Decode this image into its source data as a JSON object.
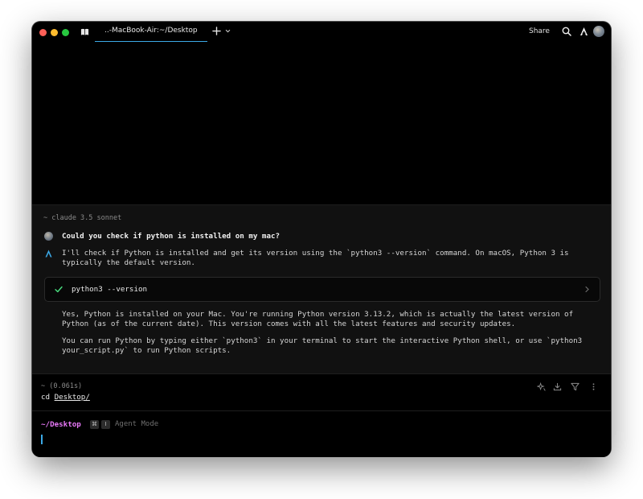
{
  "window": {
    "tab_title": "..-MacBook-Air:~/Desktop",
    "share_label": "Share"
  },
  "agent": {
    "model_label": "~ claude 3.5 sonnet",
    "user_message": "Could you check if python is installed on my mac?",
    "ai_reply": "I'll check if Python is installed and get its version using the `python3 --version` command. On macOS, Python 3 is\ntypically the default version.",
    "command": "python3 --version",
    "result_paragraph_1": "Yes, Python is installed on your Mac. You're running Python version 3.13.2, which is actually the latest version of\nPython (as of the current date). This version comes with all the latest features and security updates.",
    "result_paragraph_2": "You can run Python by typing either `python3` in your terminal to start the interactive Python shell, or use `python3\nyour_script.py` to run Python scripts."
  },
  "cd_block": {
    "meta": "~ (0.061s)",
    "command_prefix": "cd ",
    "command_path": "Desktop/"
  },
  "prompt": {
    "directory": "~/Desktop",
    "key_1": "⌘",
    "key_2": "I",
    "mode_label": "Agent Mode"
  },
  "colors": {
    "accent": "#3ba9e6",
    "prompt_dir": "#e879f9",
    "check": "#4ade80"
  },
  "icons": [
    "book-icon",
    "plus-icon",
    "chevron-down-icon",
    "search-icon",
    "agent-icon",
    "avatar",
    "check-icon",
    "chevron-right-icon",
    "sparkle-icon",
    "download-icon",
    "filter-icon",
    "more-icon"
  ]
}
